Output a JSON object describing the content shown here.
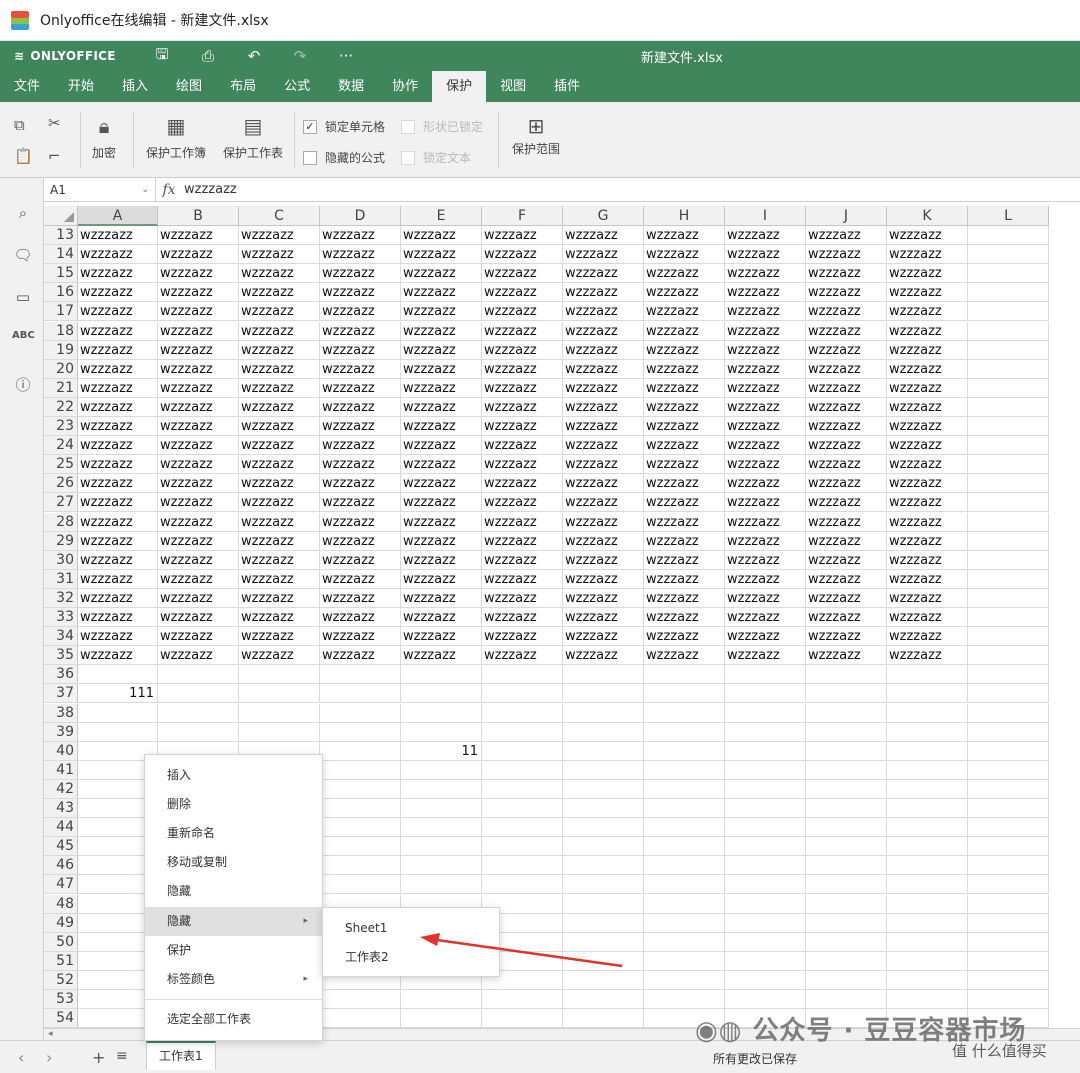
{
  "window": {
    "title": "Onlyoffice在线编辑 - 新建文件.xlsx"
  },
  "header": {
    "brand": "ONLYOFFICE",
    "doc_title": "新建文件.xlsx"
  },
  "menu_tabs": [
    "文件",
    "开始",
    "插入",
    "绘图",
    "布局",
    "公式",
    "数据",
    "协作",
    "保护",
    "视图",
    "插件"
  ],
  "active_tab": "保护",
  "ribbon": {
    "encrypt": "加密",
    "protect_workbook": "保护工作簿",
    "protect_sheet": "保护工作表",
    "lock_cell": "锁定单元格",
    "lock_cell_checked": true,
    "hidden_formula": "隐藏的公式",
    "shape_locked": "形状已锁定",
    "lock_text": "锁定文本",
    "protect_range": "保护范围"
  },
  "formula_bar": {
    "cell_ref": "A1",
    "fx": "fx",
    "value": "wzzzazz"
  },
  "sheet": {
    "columns": [
      "A",
      "B",
      "C",
      "D",
      "E",
      "F",
      "G",
      "H",
      "I",
      "J",
      "K",
      "L"
    ],
    "first_row": 13,
    "last_row": 54,
    "fill_rows_end": 35,
    "fill_value": "wzzzazz",
    "extra_values": [
      {
        "row": 37,
        "col": "A",
        "value": "111"
      },
      {
        "row": 40,
        "col": "E",
        "value": "11"
      }
    ]
  },
  "context_menu": {
    "items": [
      "插入",
      "删除",
      "重新命名",
      "移动或复制",
      "隐藏",
      "隐藏",
      "保护",
      "标签颜色",
      "选定全部工作表"
    ],
    "submenu": [
      "Sheet1",
      "工作表2"
    ]
  },
  "statusbar": {
    "sheet_tab": "工作表1",
    "save_status": "所有更改已保存"
  },
  "watermark": {
    "text": "公众号 · 豆豆容器市场",
    "corner": "值 什么值得买"
  },
  "colors": {
    "brand_green": "#40865c",
    "arrow_red": "#e0332b"
  }
}
